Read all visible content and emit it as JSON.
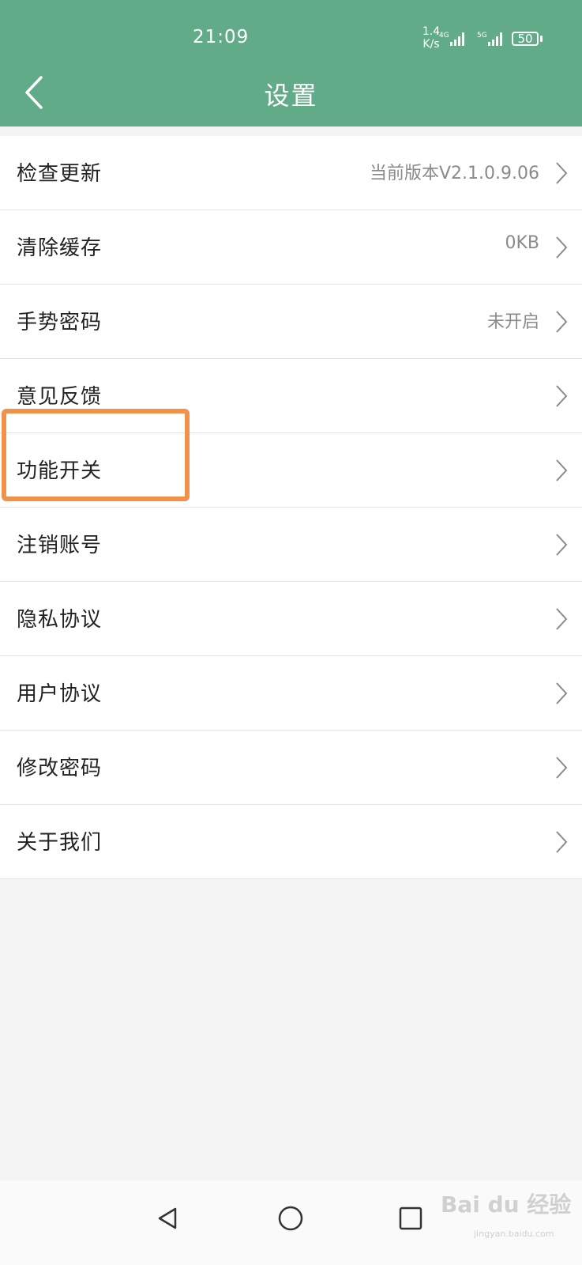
{
  "status_bar": {
    "time": "21:09",
    "net_speed_value": "1.4",
    "net_speed_unit": "K/s",
    "signal1_label": "4G",
    "signal2_label": "5G",
    "battery": "50"
  },
  "header": {
    "title": "设置",
    "back_icon": "chevron-left-icon"
  },
  "settings": [
    {
      "label": "检查更新",
      "value": "当前版本V2.1.0.9.06"
    },
    {
      "label": "清除缓存",
      "value": "0KB"
    },
    {
      "label": "手势密码",
      "value": "未开启"
    },
    {
      "label": "意见反馈",
      "value": ""
    },
    {
      "label": "功能开关",
      "value": ""
    },
    {
      "label": "注销账号",
      "value": ""
    },
    {
      "label": "隐私协议",
      "value": ""
    },
    {
      "label": "用户协议",
      "value": ""
    },
    {
      "label": "修改密码",
      "value": ""
    },
    {
      "label": "关于我们",
      "value": ""
    }
  ],
  "watermark": {
    "brand": "Bai du 经验",
    "url": "jingyan.baidu.com"
  },
  "colors": {
    "header_bg": "#62ab89",
    "highlight": "#f0924a"
  }
}
